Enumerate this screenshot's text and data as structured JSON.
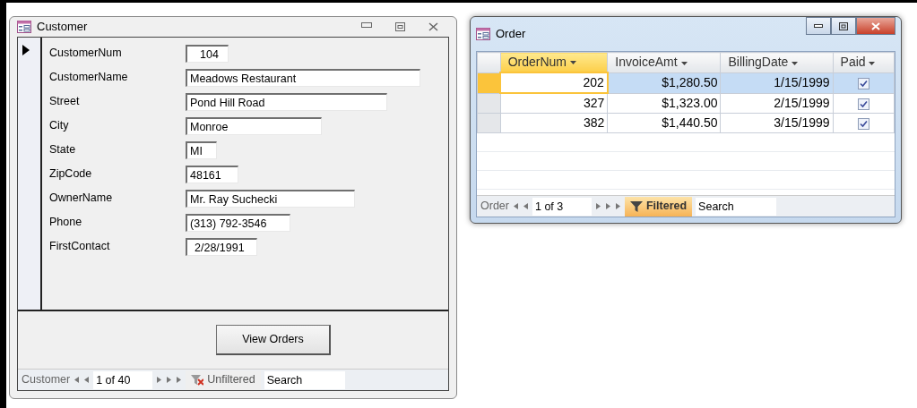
{
  "customer_window": {
    "title": "Customer",
    "fields": [
      {
        "label": "CustomerNum",
        "value": "104"
      },
      {
        "label": "CustomerName",
        "value": "Meadows Restaurant"
      },
      {
        "label": "Street",
        "value": "Pond Hill Road"
      },
      {
        "label": "City",
        "value": "Monroe"
      },
      {
        "label": "State",
        "value": "MI"
      },
      {
        "label": "ZipCode",
        "value": "48161"
      },
      {
        "label": "OwnerName",
        "value": "Mr. Ray Suchecki"
      },
      {
        "label": "Phone",
        "value": "(313) 792-3546"
      },
      {
        "label": "FirstContact",
        "value": "2/28/1991"
      }
    ],
    "button": "View Orders",
    "navigator": {
      "label": "Customer",
      "position": "1 of 40",
      "filter": "Unfiltered",
      "filtered": false,
      "search_placeholder": "Search"
    }
  },
  "order_window": {
    "title": "Order",
    "columns": [
      {
        "label": "OrderNum",
        "selected": true
      },
      {
        "label": "InvoiceAmt",
        "selected": false
      },
      {
        "label": "BillingDate",
        "selected": false
      },
      {
        "label": "Paid",
        "selected": false
      }
    ],
    "rows": [
      {
        "order_num": "202",
        "invoice_amt": "$1,280.50",
        "billing_date": "1/15/1999",
        "paid": true,
        "selected": true
      },
      {
        "order_num": "327",
        "invoice_amt": "$1,323.00",
        "billing_date": "2/15/1999",
        "paid": true,
        "selected": false
      },
      {
        "order_num": "382",
        "invoice_amt": "$1,440.50",
        "billing_date": "3/15/1999",
        "paid": true,
        "selected": false
      }
    ],
    "navigator": {
      "label": "Order",
      "position": "1 of 3",
      "filter": "Filtered",
      "filtered": true,
      "search_placeholder": "Search"
    }
  }
}
